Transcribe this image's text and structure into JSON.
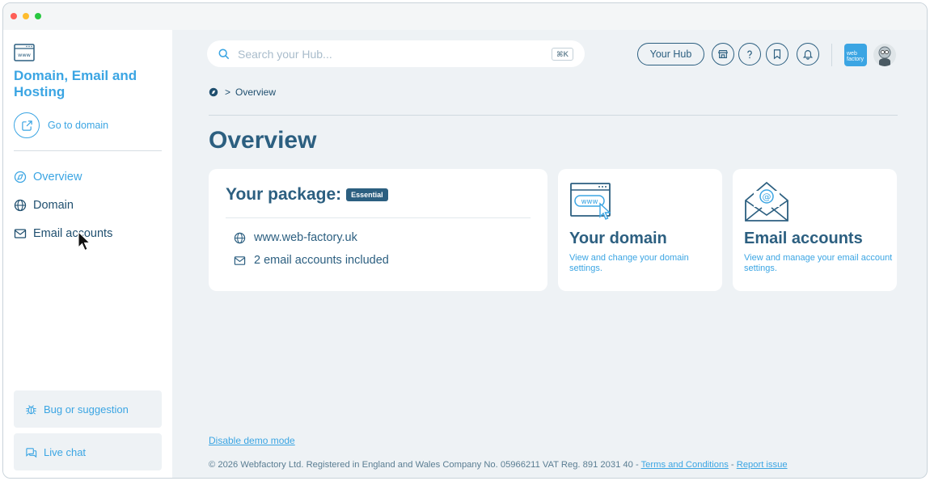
{
  "sidebar": {
    "title": "Domain, Email and Hosting",
    "goto_label": "Go to domain",
    "items": [
      {
        "label": "Overview",
        "icon": "overview-icon",
        "active": true
      },
      {
        "label": "Domain",
        "icon": "globe-icon",
        "active": false
      },
      {
        "label": "Email accounts",
        "icon": "mail-icon",
        "active": false
      }
    ],
    "bug_label": "Bug or suggestion",
    "chat_label": "Live chat"
  },
  "header": {
    "search_placeholder": "Search your Hub...",
    "search_shortcut": "⌘K",
    "hub_label": "Your Hub",
    "logo_text_line1": "web",
    "logo_text_line2": "factory"
  },
  "breadcrumb": {
    "current": "Overview"
  },
  "page": {
    "title": "Overview"
  },
  "package_card": {
    "title": "Your package:",
    "badge": "Essential",
    "domain": "www.web-factory.uk",
    "email_info": "2 email accounts included"
  },
  "domain_card": {
    "illustration_text": "www",
    "title": "Your domain",
    "description": "View and change your domain settings."
  },
  "email_card": {
    "title": "Email accounts",
    "description": "View and manage your email account settings."
  },
  "footer": {
    "demo_link": "Disable demo mode",
    "copyright": "© 2026 Webfactory Ltd. Registered in England and Wales Company No. 05966211 VAT Reg. 891 2031 40 -",
    "terms": "Terms and Conditions",
    "dash": "-",
    "report": "Report issue"
  },
  "colors": {
    "accent": "#3ba5e3",
    "primary": "#2c5f80",
    "background": "#eef2f5"
  }
}
